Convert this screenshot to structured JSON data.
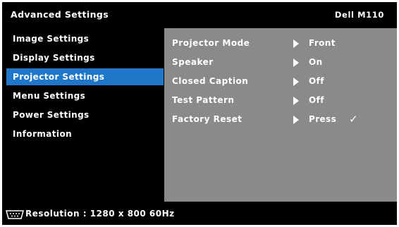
{
  "header": {
    "title": "Advanced Settings",
    "model": "Dell M110"
  },
  "menu": {
    "items": [
      {
        "label": "Image Settings",
        "selected": false
      },
      {
        "label": "Display Settings",
        "selected": false
      },
      {
        "label": "Projector Settings",
        "selected": true
      },
      {
        "label": "Menu Settings",
        "selected": false
      },
      {
        "label": "Power Settings",
        "selected": false
      },
      {
        "label": "Information",
        "selected": false
      }
    ]
  },
  "settings": {
    "rows": [
      {
        "label": "Projector Mode",
        "value": "Front"
      },
      {
        "label": "Speaker",
        "value": "On"
      },
      {
        "label": "Closed Caption",
        "value": "Off"
      },
      {
        "label": "Test Pattern",
        "value": "Off"
      },
      {
        "label": "Factory Reset",
        "value": "Press",
        "check": "✓"
      }
    ]
  },
  "status": {
    "icon": "vga-connector-icon",
    "resolution": "Resolution : 1280 x 800 60Hz"
  },
  "colors": {
    "background": "#000000",
    "selected": "#1e77c9",
    "panel": "#8a8a8a",
    "text": "#ffffff"
  }
}
